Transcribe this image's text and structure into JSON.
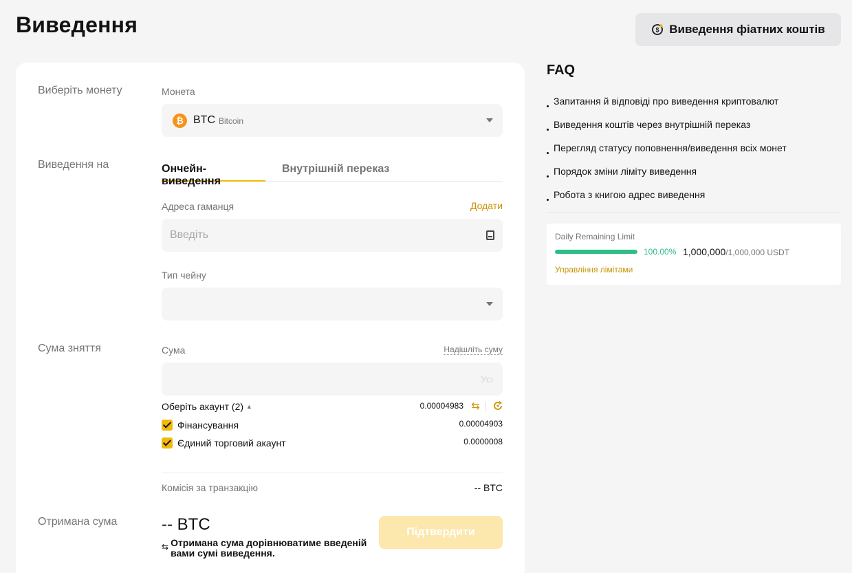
{
  "header": {
    "title": "Виведення",
    "fiat_button": "Виведення фіатних коштів"
  },
  "form": {
    "coin_section": {
      "left_label": "Виберіть монету",
      "field_label": "Монета",
      "symbol": "BTC",
      "name": "Bitcoin",
      "icon": "bitcoin-icon"
    },
    "destination_section": {
      "left_label": "Виведення на",
      "tabs": [
        {
          "label": "Ончейн-виведення",
          "active": true
        },
        {
          "label": "Внутрішній переказ",
          "active": false
        }
      ],
      "address_label": "Адреса гаманця",
      "address_add": "Додати",
      "address_placeholder": "Введіть",
      "chain_label": "Тип чейну"
    },
    "amount_section": {
      "left_label": "Сума зняття",
      "field_label": "Сума",
      "send_max_link": "Надішліть суму",
      "all_label": "Усі",
      "account_select": "Оберіть акаунт (2)",
      "account_total": "0.00004983",
      "accounts": [
        {
          "name": "Фінансування",
          "value": "0.00004903",
          "checked": true
        },
        {
          "name": "Єдиний торговий акаунт",
          "value": "0.0000008",
          "checked": true
        }
      ],
      "fee_label": "Комісія за транзакцію",
      "fee_value": "-- BTC"
    },
    "receive_section": {
      "left_label": "Отримана сума",
      "amount": "-- BTC",
      "note": "Отримана сума дорівнюватиме введеній вами сумі виведення.",
      "confirm_button": "Підтвердити"
    }
  },
  "faq": {
    "title": "FAQ",
    "items": [
      "Запитання й відповіді про виведення криптовалют",
      "Виведення коштів через внутрішній переказ",
      "Перегляд статусу поповнення/виведення всіх монет",
      "Порядок зміни ліміту виведення",
      "Робота з книгою адрес виведення"
    ]
  },
  "limit": {
    "title": "Daily Remaining Limit",
    "progress_percent": 100,
    "percent_text": "100.00%",
    "remaining": "1,000,000",
    "total": "/1,000,000 USDT",
    "manage_link": "Управління лімітами"
  },
  "colors": {
    "accent": "#f0b90b",
    "link": "#c99400",
    "success": "#2ebd85",
    "confirm_disabled": "#fce8ad"
  }
}
